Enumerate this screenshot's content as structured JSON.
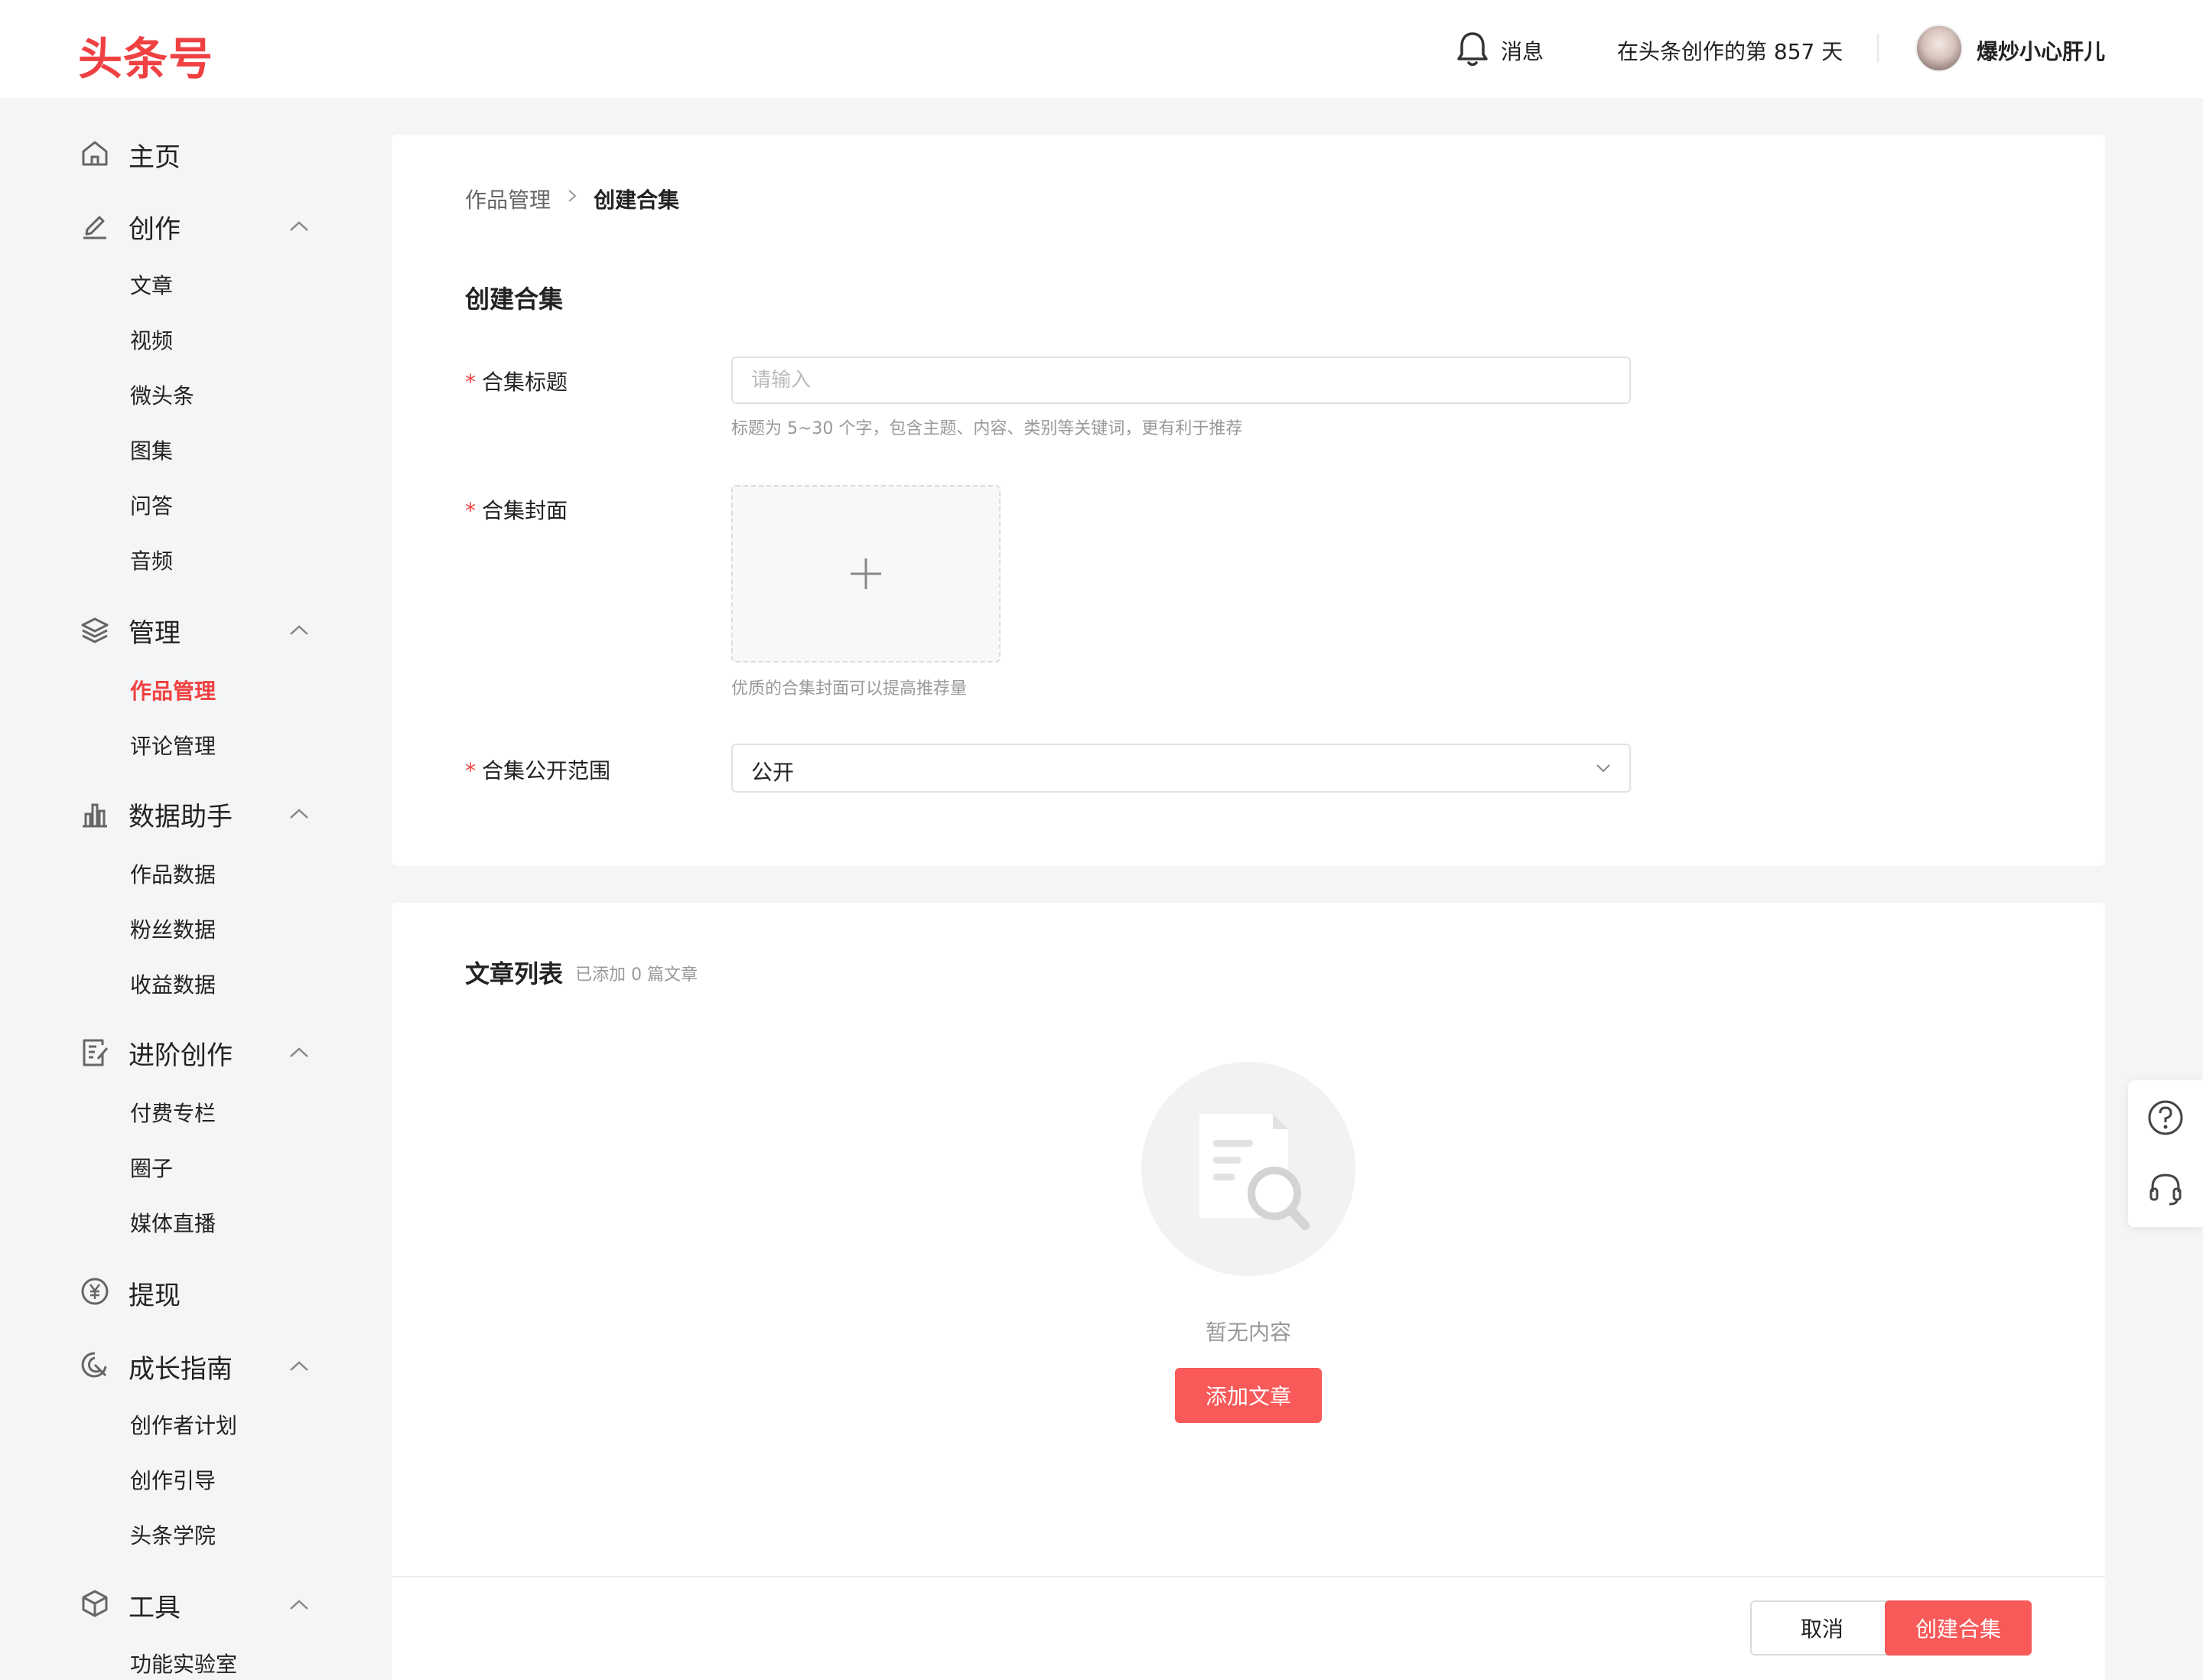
{
  "header": {
    "logo": "头条号",
    "messages_label": "消息",
    "days_text": "在头条创作的第 857 天",
    "username": "爆炒小心肝儿"
  },
  "sidebar": {
    "home": "主页",
    "create": {
      "title": "创作",
      "items": [
        "文章",
        "视频",
        "微头条",
        "图集",
        "问答",
        "音频"
      ]
    },
    "manage": {
      "title": "管理",
      "items": [
        "作品管理",
        "评论管理"
      ],
      "active_item": "作品管理"
    },
    "data": {
      "title": "数据助手",
      "items": [
        "作品数据",
        "粉丝数据",
        "收益数据"
      ]
    },
    "advanced": {
      "title": "进阶创作",
      "items": [
        "付费专栏",
        "圈子",
        "媒体直播"
      ]
    },
    "withdraw": "提现",
    "growth": {
      "title": "成长指南",
      "items": [
        "创作者计划",
        "创作引导",
        "头条学院"
      ]
    },
    "tools": {
      "title": "工具",
      "items": [
        "功能实验室"
      ]
    }
  },
  "breadcrumb": {
    "parent": "作品管理",
    "current": "创建合集"
  },
  "form": {
    "section_title": "创建合集",
    "title_label": "合集标题",
    "title_placeholder": "请输入",
    "title_value": "",
    "title_hint": "标题为 5~30 个字，包含主题、内容、类别等关键词，更有利于推荐",
    "cover_label": "合集封面",
    "cover_hint": "优质的合集封面可以提高推荐量",
    "visibility_label": "合集公开范围",
    "visibility_value": "公开",
    "required_mark": "*"
  },
  "article_list": {
    "title": "文章列表",
    "count_text": "已添加 0 篇文章",
    "empty_text": "暂无内容",
    "add_button": "添加文章"
  },
  "footer": {
    "cancel": "取消",
    "create": "创建合集"
  },
  "colors": {
    "brand": "#f04142",
    "button": "#f85959",
    "background": "#f4f5f6"
  },
  "icons": [
    "bell-icon",
    "home-icon",
    "edit-icon",
    "layers-icon",
    "bar-chart-icon",
    "document-edit-icon",
    "yuan-icon",
    "growth-icon",
    "cube-icon",
    "chevron-up-icon",
    "chevron-right-icon",
    "chevron-down-icon",
    "plus-icon",
    "empty-document-search-icon",
    "help-icon",
    "customer-service-icon"
  ]
}
